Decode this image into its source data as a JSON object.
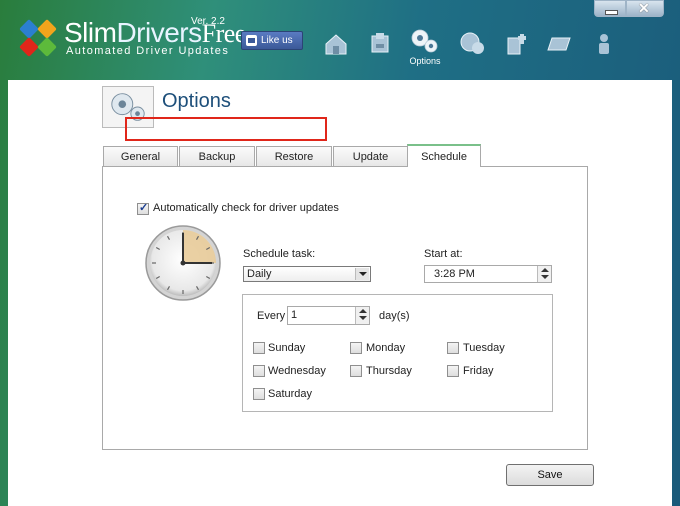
{
  "app": {
    "name_slim": "Slim",
    "name_drivers": "Drivers",
    "name_free": "Free",
    "version": "Ver. 2.2",
    "subtitle": "Automated Driver Updates",
    "like_label": "Like us"
  },
  "nav": {
    "active_label": "Options",
    "icons": [
      "home-icon",
      "scan-icon",
      "options-gear-icon",
      "backup-icon",
      "tools-icon",
      "restore-icon",
      "user-icon"
    ]
  },
  "page": {
    "title": "Options"
  },
  "tabs": [
    {
      "label": "General",
      "active": false
    },
    {
      "label": "Backup",
      "active": false
    },
    {
      "label": "Restore",
      "active": false
    },
    {
      "label": "Update",
      "active": false
    },
    {
      "label": "Schedule",
      "active": true
    }
  ],
  "schedule": {
    "auto_check_label": "Automatically check for driver updates",
    "auto_check_checked": true,
    "schedule_task_label": "Schedule task:",
    "schedule_task_value": "Daily",
    "start_at_label": "Start at:",
    "start_at_value": "3:28 PM",
    "every_label": "Every",
    "every_value": "1",
    "every_unit": "day(s)",
    "days": [
      {
        "label": "Sunday",
        "checked": false
      },
      {
        "label": "Monday",
        "checked": false
      },
      {
        "label": "Tuesday",
        "checked": false
      },
      {
        "label": "Wednesday",
        "checked": false
      },
      {
        "label": "Thursday",
        "checked": false
      },
      {
        "label": "Friday",
        "checked": false
      },
      {
        "label": "Saturday",
        "checked": false
      }
    ]
  },
  "buttons": {
    "save_label": "Save"
  },
  "colors": {
    "accent_green": "#7ac08a",
    "highlight_red": "#e0261a",
    "title_blue": "#1d4f7a",
    "facebook_blue": "#3b5998"
  }
}
